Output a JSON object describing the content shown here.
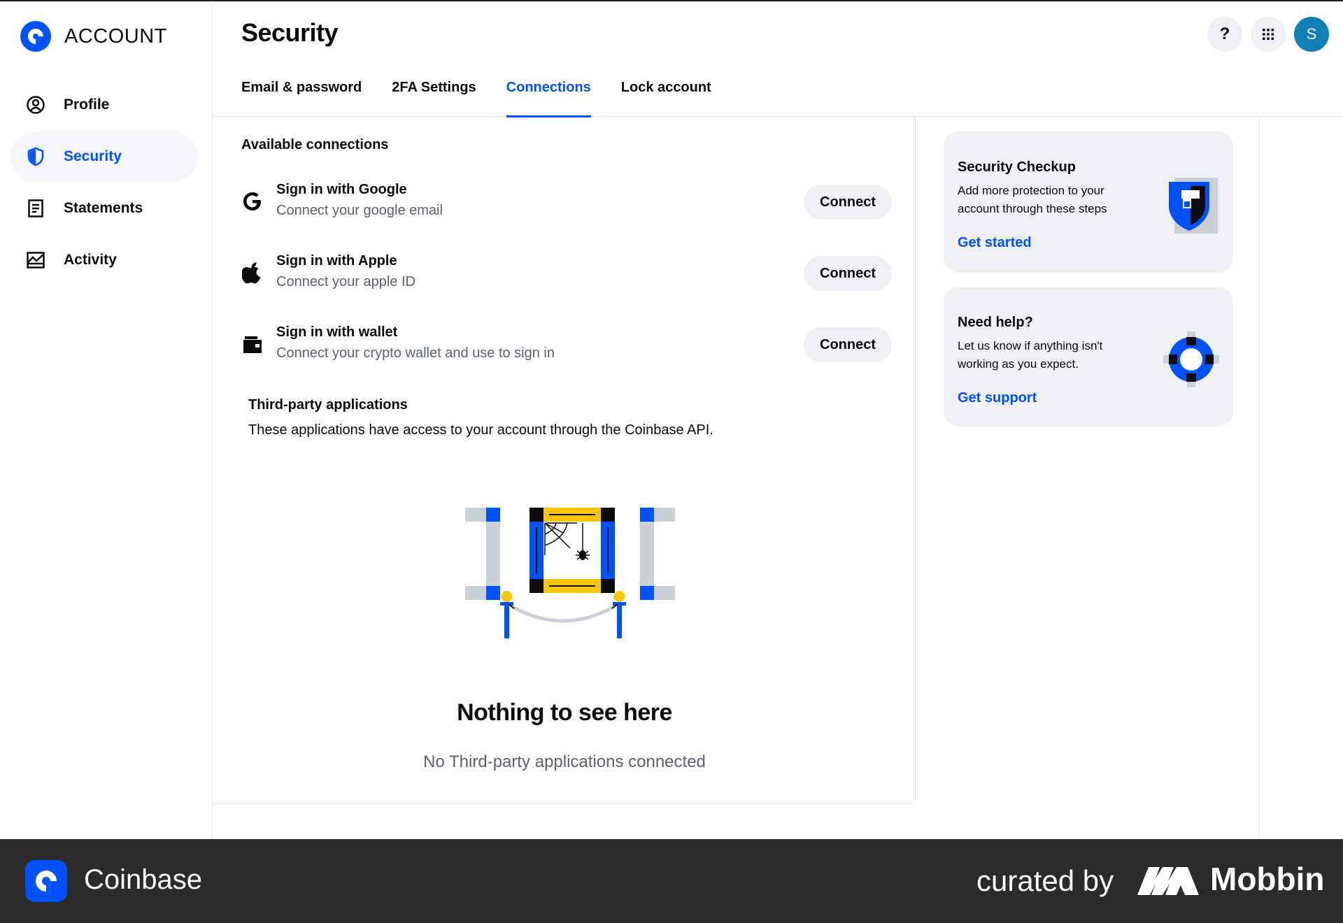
{
  "sidebar": {
    "brand": "ACCOUNT",
    "items": [
      {
        "label": "Profile",
        "icon": "profile-icon",
        "active": false
      },
      {
        "label": "Security",
        "icon": "shield-icon",
        "active": true
      },
      {
        "label": "Statements",
        "icon": "document-icon",
        "active": false
      },
      {
        "label": "Activity",
        "icon": "activity-icon",
        "active": false
      }
    ]
  },
  "header": {
    "title": "Security",
    "tabs": [
      {
        "label": "Email & password",
        "active": false
      },
      {
        "label": "2FA Settings",
        "active": false
      },
      {
        "label": "Connections",
        "active": true
      },
      {
        "label": "Lock account",
        "active": false
      }
    ],
    "actions": {
      "help": "?",
      "avatar_initial": "S"
    }
  },
  "main": {
    "available_title": "Available connections",
    "connections": [
      {
        "title": "Sign in with Google",
        "subtitle": "Connect your google email",
        "button": "Connect",
        "icon": "google-icon"
      },
      {
        "title": "Sign in with Apple",
        "subtitle": "Connect your apple ID",
        "button": "Connect",
        "icon": "apple-icon"
      },
      {
        "title": "Sign in with wallet",
        "subtitle": "Connect your crypto wallet and use to sign in",
        "button": "Connect",
        "icon": "wallet-icon"
      }
    ],
    "third_party_title": "Third-party applications",
    "third_party_desc": "These applications have access to your account through the Coinbase API.",
    "empty_title": "Nothing to see here",
    "empty_subtitle": "No Third-party applications connected"
  },
  "cards": {
    "checkup": {
      "title": "Security Checkup",
      "text": "Add more protection to your account through these steps",
      "link": "Get started"
    },
    "help": {
      "title": "Need help?",
      "text": "Let us know if anything isn't working as you expect.",
      "link": "Get support"
    }
  },
  "footer": {
    "brand": "Coinbase",
    "curated": "curated by",
    "mobbin": "Mobbin"
  },
  "colors": {
    "accent": "#0052ff",
    "active_bg": "#f4f6fb",
    "muted_text": "#5b616e",
    "card_bg": "#eef0f3",
    "footer_bg": "#2b2b2b"
  }
}
